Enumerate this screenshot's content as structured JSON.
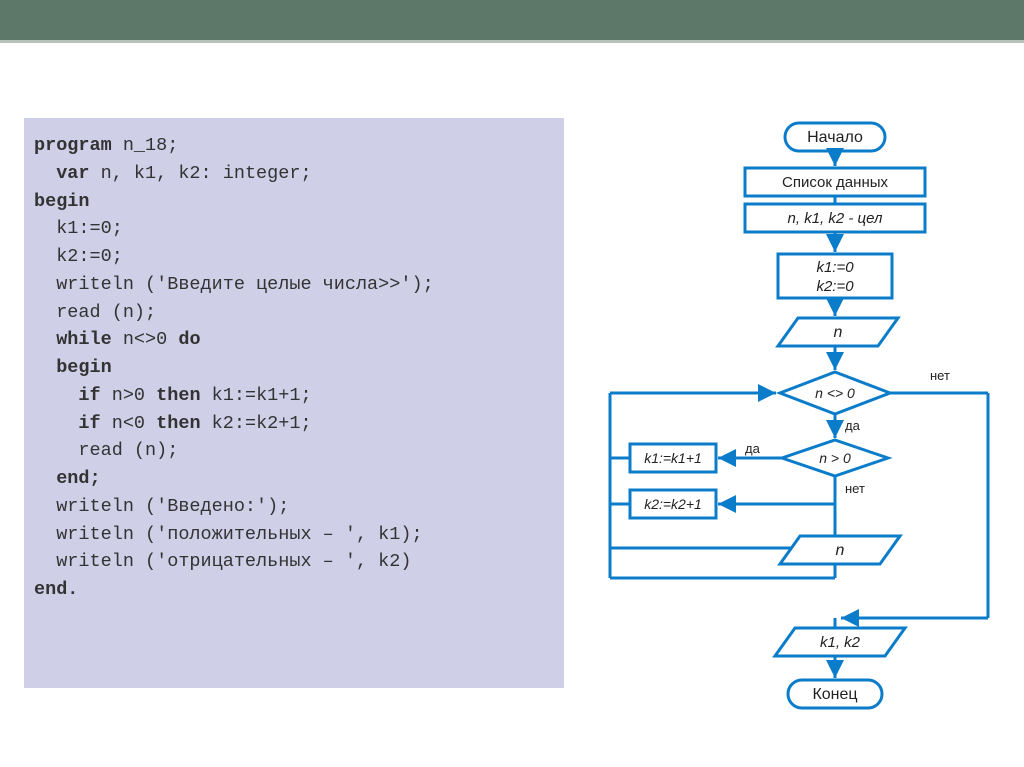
{
  "code": {
    "l1a": "program",
    "l1b": " n_18;",
    "l2a": "  var",
    "l2b": " n, k1, k2: integer;",
    "l3": "begin",
    "l4": "  k1:=0;",
    "l5": "  k2:=0;",
    "l6": "  writeln ('Введите целые числа>>');",
    "l7": "  read (n);",
    "l8a": "  while",
    "l8b": " n<>0 ",
    "l8c": "do",
    "l9": "  begin",
    "l10a": "    if",
    "l10b": " n>0 ",
    "l10c": "then",
    "l10d": " k1:=k1+1;",
    "l11a": "    if",
    "l11b": " n<0 ",
    "l11c": "then",
    "l11d": " k2:=k2+1;",
    "l12": "    read (n);",
    "l13": "  end;",
    "l14": "  writeln ('Введено:');",
    "l15": "  writeln ('положительных – ', k1);",
    "l16": "  writeln ('отрицательных – ', k2)",
    "l17": "end."
  },
  "flow": {
    "start": "Начало",
    "data_list": "Список данных",
    "vars": "n, k1, k2 - цел",
    "init1": "k1:=0",
    "init2": "k2:=0",
    "read_n1": "n",
    "cond1": "n <> 0",
    "cond2": "n > 0",
    "yes": "да",
    "no": "нет",
    "inc_k1": "k1:=k1+1",
    "inc_k2": "k2:=k2+1",
    "read_n2": "n",
    "out": "k1, k2",
    "end": "Конец"
  }
}
